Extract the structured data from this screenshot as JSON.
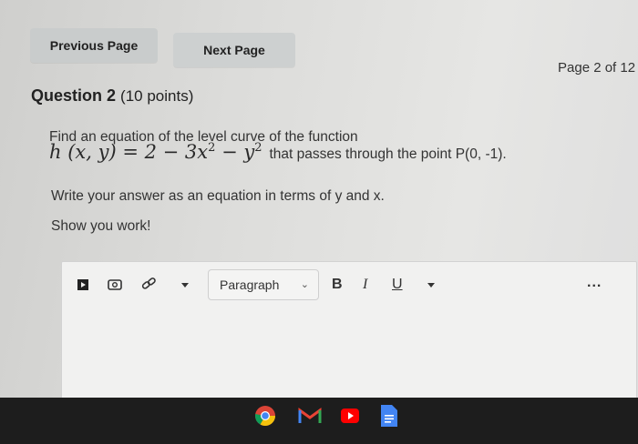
{
  "nav": {
    "previous": "Previous Page",
    "next": "Next Page"
  },
  "page_indicator": "Page 2 of 12",
  "question": {
    "title": "Question 2",
    "points": "(10 points)",
    "line1": "Find an equation of the level curve of the function",
    "formula_lhs": "h (x, y) = 2 − 3x",
    "formula_mid": " − y",
    "formula_exp": "2",
    "line1_tail": "that passes through the point P(0, -1).",
    "line2": "Write your answer as an equation in terms of y and x.",
    "line3": "Show you work!"
  },
  "editor": {
    "paragraph_label": "Paragraph",
    "bold": "B",
    "italic": "I",
    "underline": "U",
    "more": "..."
  },
  "icons": [
    "media-icon",
    "image-icon",
    "link-icon",
    "dropdown-arrow-icon",
    "chrome-icon",
    "gmail-icon",
    "youtube-icon",
    "docs-icon"
  ]
}
